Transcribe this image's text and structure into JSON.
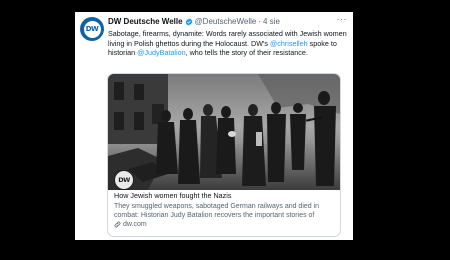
{
  "tweet": {
    "avatar_text": "DW",
    "display_name": "DW Deutsche Welle",
    "handle": "@DeutscheWelle",
    "separator": "·",
    "time": "4 sie",
    "more": "···",
    "text": {
      "part1": "Sabotage, firearms, dynamite: Words rarely associated with Jewish women living in Polish ghettos during the Holocaust. DW's ",
      "mention1": "@chriselleh",
      "part2": " spoke to historian ",
      "mention2": "@JudyBatalion",
      "part3": ", who tells the story of their resistance."
    }
  },
  "card": {
    "photo_logo": "DW",
    "title": "How Jewish women fought the Nazis",
    "description": "They smuggled weapons, sabotaged German railways and died in combat: Historian Judy Batalion recovers the important stories of Jewis...",
    "domain": "dw.com"
  },
  "icons": {
    "verified": "verified-badge-icon",
    "more": "more-options-icon",
    "link": "link-icon"
  },
  "colors": {
    "link": "#1d9bf0",
    "brand": "#0c63a6",
    "background": "#000000"
  }
}
